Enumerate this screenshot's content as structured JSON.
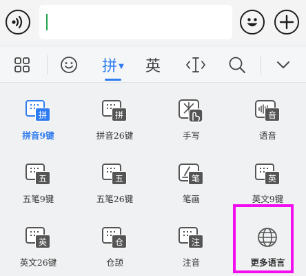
{
  "chat": {
    "voice_icon": "voice-wave-icon",
    "emoji_icon": "smiley-icon",
    "plus_icon": "plus-icon",
    "input_value": ""
  },
  "toolbar": {
    "items": [
      {
        "id": "menu",
        "icon": "grid-icon"
      },
      {
        "id": "emoji",
        "icon": "smiley-icon"
      },
      {
        "id": "pinyin",
        "label": "拼",
        "active": true,
        "dropdown_icon": "triangle-down-icon"
      },
      {
        "id": "english",
        "label": "英"
      },
      {
        "id": "cursor",
        "icon": "text-cursor-icon"
      },
      {
        "id": "search",
        "icon": "search-icon"
      },
      {
        "id": "collapse",
        "icon": "chevron-down-icon"
      }
    ]
  },
  "keyboards": [
    {
      "label": "拼音9键",
      "badge": "拼",
      "selected": true
    },
    {
      "label": "拼音26键",
      "badge": "拼"
    },
    {
      "label": "手写",
      "icon": "handwriting-icon"
    },
    {
      "label": "语音",
      "badge": "音",
      "icon": "voice-keyboard-icon"
    },
    {
      "label": "五笔9键",
      "badge": "五"
    },
    {
      "label": "五笔26键",
      "badge": "五"
    },
    {
      "label": "笔画",
      "badge": "笔",
      "icon": "stroke-icon"
    },
    {
      "label": "英文9键",
      "badge": "英"
    },
    {
      "label": "英文26键",
      "badge": "英"
    },
    {
      "label": "仓颉",
      "badge": "仓"
    },
    {
      "label": "注音",
      "badge": "注"
    },
    {
      "label": "更多语言",
      "icon": "globe-icon",
      "selected": true,
      "highlight_color": "#f20cf0"
    }
  ],
  "colors": {
    "accent": "#2f7cf0",
    "highlight": "#f20cf0",
    "caret": "#21a34a"
  }
}
